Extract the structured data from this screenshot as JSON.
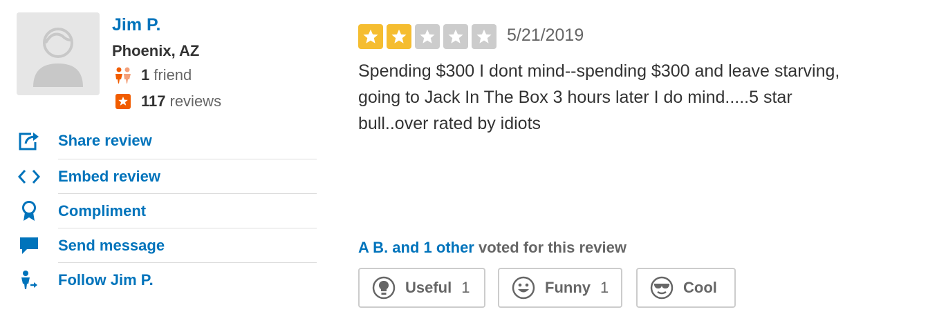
{
  "user": {
    "name": "Jim P.",
    "location": "Phoenix, AZ",
    "friends_count": "1",
    "friends_label": "friend",
    "reviews_count": "117",
    "reviews_label": "reviews",
    "avatar_icon": "default-avatar-icon",
    "friends_icon": "friends-icon",
    "reviews_icon": "reviews-star-icon"
  },
  "actions": [
    {
      "label": "Share review",
      "icon": "share-icon"
    },
    {
      "label": "Embed review",
      "icon": "embed-code-icon"
    },
    {
      "label": "Compliment",
      "icon": "award-ribbon-icon"
    },
    {
      "label": "Send message",
      "icon": "message-bubble-icon"
    },
    {
      "label": "Follow Jim P.",
      "icon": "follow-user-icon"
    }
  ],
  "review": {
    "rating": 2,
    "max_rating": 5,
    "date": "5/21/2019",
    "text": "Spending $300 I dont mind--spending $300 and leave starving, going to Jack In The Box 3 hours later I do mind.....5 star bull..over rated by idiots"
  },
  "votes": {
    "voters_link": "A B. and 1 other",
    "voted_text": "voted for this review",
    "buttons": [
      {
        "label": "Useful",
        "count": "1",
        "icon": "lightbulb-icon"
      },
      {
        "label": "Funny",
        "count": "1",
        "icon": "smiley-face-icon"
      },
      {
        "label": "Cool",
        "count": "",
        "icon": "sunglasses-face-icon"
      }
    ]
  },
  "colors": {
    "link_blue": "#0073bb",
    "star_on": "#f5bd30",
    "star_off": "#cccccc",
    "reviews_badge": "#f15c00",
    "friends_icon": "#f15c00"
  }
}
